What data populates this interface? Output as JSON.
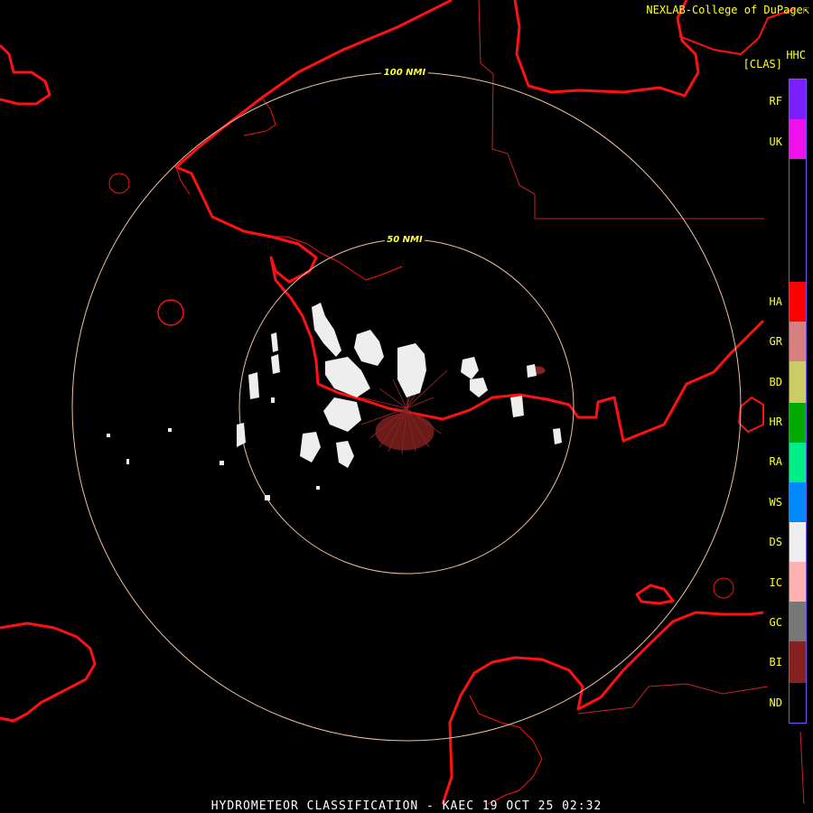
{
  "header": {
    "credit": "NEXLAB-College of DuPage",
    "product_code": "HHC",
    "mode": "[CLAS]"
  },
  "footer": {
    "caption": "HYDROMETEOR CLASSIFICATION - KAEC 19 OCT 25 02:32"
  },
  "range_rings": [
    {
      "label": "50 NMI"
    },
    {
      "label": "100 NMI"
    }
  ],
  "legend": [
    {
      "code": "RF",
      "color": "#7a1fff"
    },
    {
      "code": "UK",
      "color": "#ee11ee"
    },
    {
      "code": "HA",
      "color": "#ff0000"
    },
    {
      "code": "GR",
      "color": "#d88080"
    },
    {
      "code": "BD",
      "color": "#cccc66"
    },
    {
      "code": "HR",
      "color": "#00aa00"
    },
    {
      "code": "RA",
      "color": "#00ee88"
    },
    {
      "code": "WS",
      "color": "#0088ff"
    },
    {
      "code": "DS",
      "color": "#eeeeee"
    },
    {
      "code": "IC",
      "color": "#ffb0b0"
    },
    {
      "code": "GC",
      "color": "#777777"
    },
    {
      "code": "BI",
      "color": "#882222"
    },
    {
      "code": "ND",
      "color": "#000000"
    }
  ],
  "colors": {
    "coastline": "#ff1111",
    "border": "#cc2222",
    "ring": "#f0c0a0",
    "echo_dry_snow": "#eeeeee",
    "echo_biological": "#882222"
  }
}
